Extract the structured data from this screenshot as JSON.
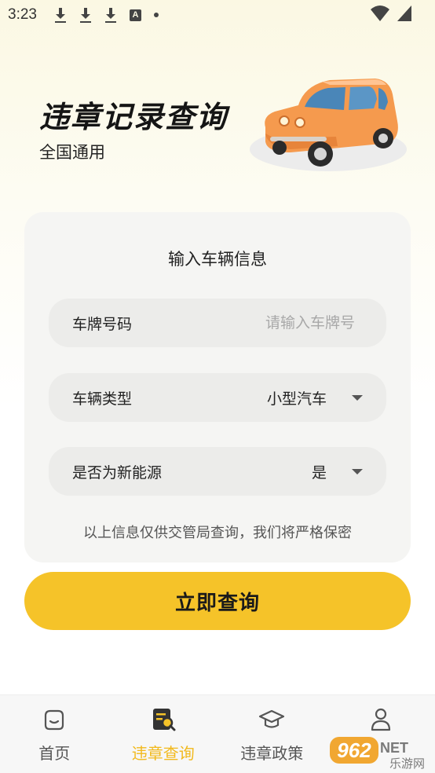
{
  "status_bar": {
    "time": "3:23",
    "icons": [
      "download-icon",
      "download-icon",
      "download-icon",
      "a-notification-icon",
      "dot-icon",
      "wifi-icon",
      "signal-icon"
    ]
  },
  "hero": {
    "title": "违章记录查询",
    "subtitle": "全国通用"
  },
  "form": {
    "title": "输入车辆信息",
    "plate": {
      "label": "车牌号码",
      "placeholder": "请输入车牌号",
      "value": ""
    },
    "vehicle_type": {
      "label": "车辆类型",
      "value": "小型汽车"
    },
    "new_energy": {
      "label": "是否为新能源",
      "value": "是"
    },
    "notice": "以上信息仅供交管局查询，我们将严格保密"
  },
  "query_button": {
    "label": "立即查询"
  },
  "bottom_nav": {
    "items": [
      {
        "label": "首页",
        "icon": "home-icon",
        "active": false
      },
      {
        "label": "违章查询",
        "icon": "violation-search-icon",
        "active": true
      },
      {
        "label": "违章政策",
        "icon": "graduation-cap-icon",
        "active": false
      },
      {
        "label": "",
        "icon": "profile-icon",
        "active": false
      }
    ]
  },
  "watermark": {
    "text": "962",
    "suffix": "NET",
    "subtext": "乐游网"
  },
  "colors": {
    "accent": "#f5c329",
    "active_nav": "#f2b91c",
    "car": "#f59a4e"
  }
}
